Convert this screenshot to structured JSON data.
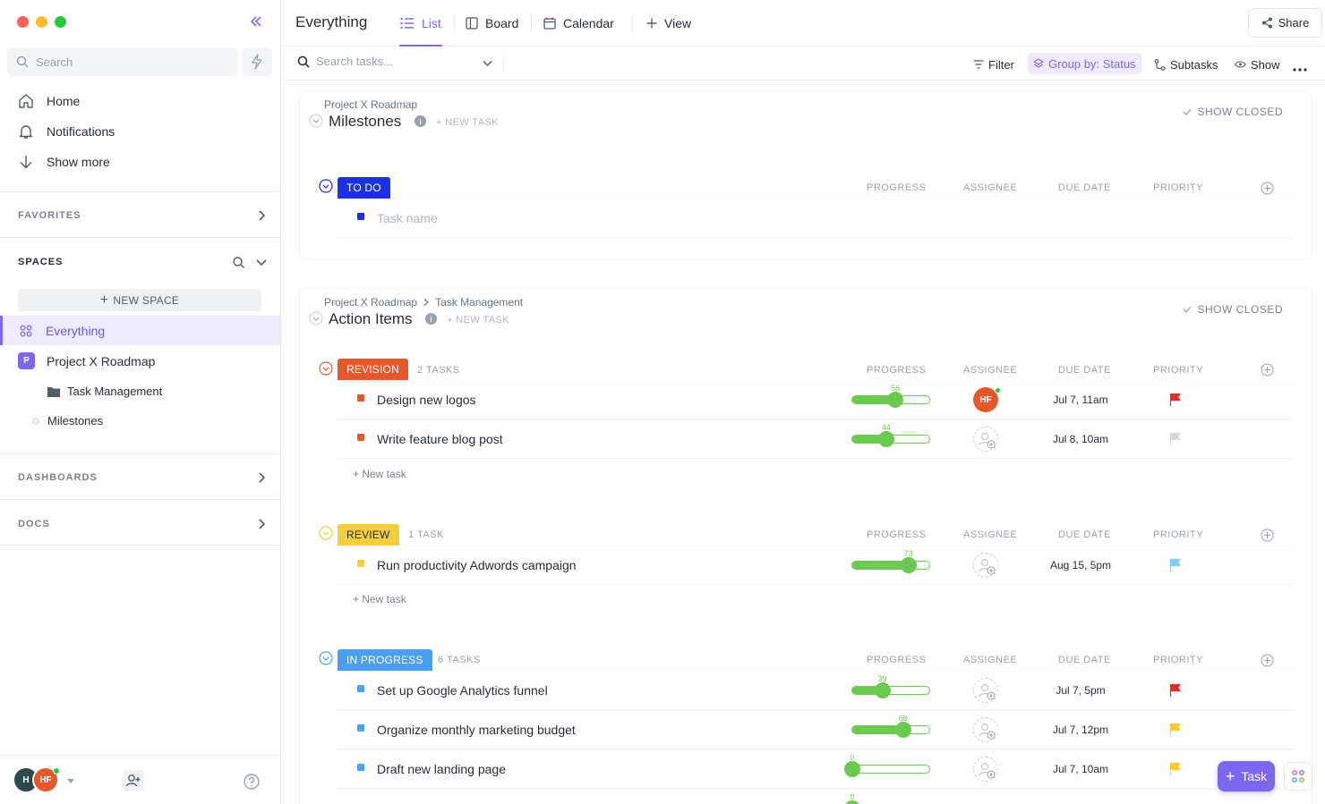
{
  "sidebar": {
    "search_placeholder": "Search",
    "nav": [
      {
        "label": "Home",
        "icon": "home-icon"
      },
      {
        "label": "Notifications",
        "icon": "bell-icon"
      },
      {
        "label": "Show more",
        "icon": "arrow-down-icon"
      }
    ],
    "favorites_label": "FAVORITES",
    "spaces_label": "SPACES",
    "new_space_label": "NEW SPACE",
    "spaces": [
      {
        "label": "Everything",
        "active": true
      },
      {
        "label": "Project X Roadmap",
        "badge": "P"
      },
      {
        "label": "Task Management"
      },
      {
        "label": "Milestones"
      }
    ],
    "dashboards_label": "DASHBOARDS",
    "docs_label": "DOCS",
    "user": {
      "initials_1": "H",
      "initials_2": "HF"
    }
  },
  "header": {
    "title": "Everything",
    "tabs": [
      {
        "label": "List",
        "active": true
      },
      {
        "label": "Board"
      },
      {
        "label": "Calendar"
      },
      {
        "label": "View"
      }
    ],
    "share_label": "Share"
  },
  "toolbar": {
    "search_placeholder": "Search tasks...",
    "filter_label": "Filter",
    "group_label": "Group by: Status",
    "subtasks_label": "Subtasks",
    "show_label": "Show"
  },
  "columns": {
    "progress": "PROGRESS",
    "assignee": "ASSIGNEE",
    "due": "DUE DATE",
    "priority": "PRIORITY"
  },
  "lists": [
    {
      "breadcrumb": [
        "Project X Roadmap"
      ],
      "title": "Milestones",
      "new_task": "+ NEW TASK",
      "show_closed": "SHOW CLOSED",
      "groups": [
        {
          "status": "TO DO",
          "color": "#1d31e2",
          "count": "",
          "placeholder": "Task name",
          "tasks": []
        }
      ]
    },
    {
      "breadcrumb": [
        "Project X Roadmap",
        "Task Management"
      ],
      "title": "Action Items",
      "new_task": "+ NEW TASK",
      "show_closed": "SHOW CLOSED",
      "groups": [
        {
          "status": "REVISION",
          "color": "#e5582c",
          "count": "2 TASKS",
          "new_task": "+ New task",
          "tasks": [
            {
              "name": "Design new logos",
              "progress": 56,
              "assignee": "HF",
              "due": "Jul 7, 11am",
              "priority": "urgent",
              "flag_color": "#e22d2d"
            },
            {
              "name": "Write feature blog post",
              "progress": 44,
              "assignee": "",
              "due": "Jul 8, 10am",
              "priority": "none",
              "flag_color": "#d5d8dc"
            }
          ]
        },
        {
          "status": "REVIEW",
          "color": "#f4cf3d",
          "count": "1 TASK",
          "new_task": "+ New task",
          "tasks": [
            {
              "name": "Run productivity Adwords campaign",
              "progress": 73,
              "assignee": "",
              "due": "Aug 15, 5pm",
              "priority": "low",
              "flag_color": "#7ecdf3"
            }
          ]
        },
        {
          "status": "IN PROGRESS",
          "color": "#4a9ff0",
          "count": "6 TASKS",
          "tasks": [
            {
              "name": "Set up Google Analytics funnel",
              "progress": 39,
              "assignee": "",
              "due": "Jul 7, 5pm",
              "priority": "urgent",
              "flag_color": "#e22d2d"
            },
            {
              "name": "Organize monthly marketing budget",
              "progress": 66,
              "assignee": "",
              "due": "Jul 7, 12pm",
              "priority": "high",
              "flag_color": "#f5cb2e"
            },
            {
              "name": "Draft new landing page",
              "progress": 0,
              "assignee": "",
              "due": "Jul 7, 10am",
              "priority": "high",
              "flag_color": "#f5cb2e"
            },
            {
              "name": "",
              "progress": 0,
              "assignee": "",
              "due": "",
              "priority": "",
              "flag_color": ""
            }
          ]
        }
      ]
    }
  ],
  "fab_label": "Task",
  "colors": {
    "accent": "#7b68ee",
    "progress": "#6bc950"
  }
}
